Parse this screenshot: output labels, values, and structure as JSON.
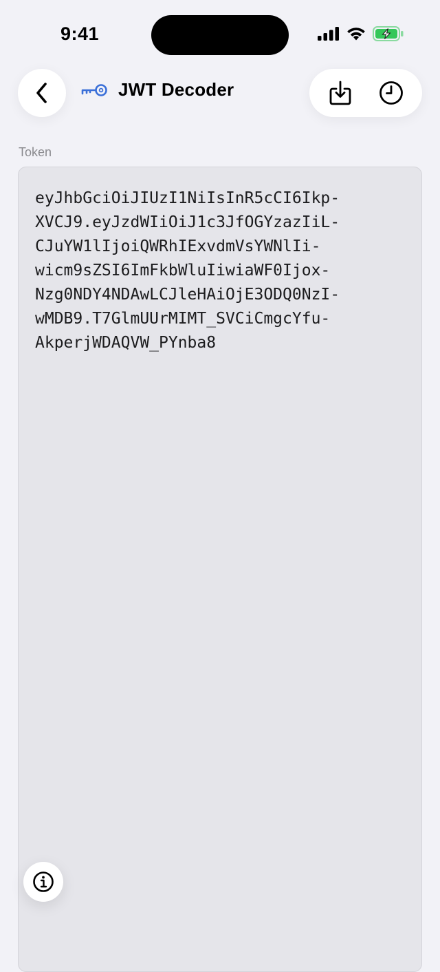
{
  "status_bar": {
    "time": "9:41",
    "icons": [
      "cellular-signal-icon",
      "wifi-icon",
      "battery-charging-icon"
    ],
    "battery_color": "#34c759"
  },
  "nav": {
    "title": "JWT Decoder",
    "title_icon": "key-icon",
    "accent_color": "#3a6fd8",
    "back_icon": "chevron-left-icon",
    "actions": [
      {
        "icon": "import-download-icon"
      },
      {
        "icon": "history-clock-icon"
      }
    ]
  },
  "token": {
    "label": "Token",
    "lines": [
      "eyJhbGciOiJIUzI1NiIsInR5cCI6Ikp-",
      "XVCJ9.eyJzdWIiOiJ1c3JfOGYzazIiL-",
      "CJuYW1lIjoiQWRhIExvdmVsYWNlIi-",
      "wicm9sZSI6ImFkbWluIiwiaWF0Ijox-",
      "Nzg0NDY4NDAwLCJleHAiOjE3ODQ0NzI-",
      "wMDB9.T7GlmUUrMIMT_SVCiCmgcYfu-",
      "AkperjWDAQVW_PYnba8"
    ]
  },
  "info_button": {
    "icon": "info-circle-icon"
  }
}
